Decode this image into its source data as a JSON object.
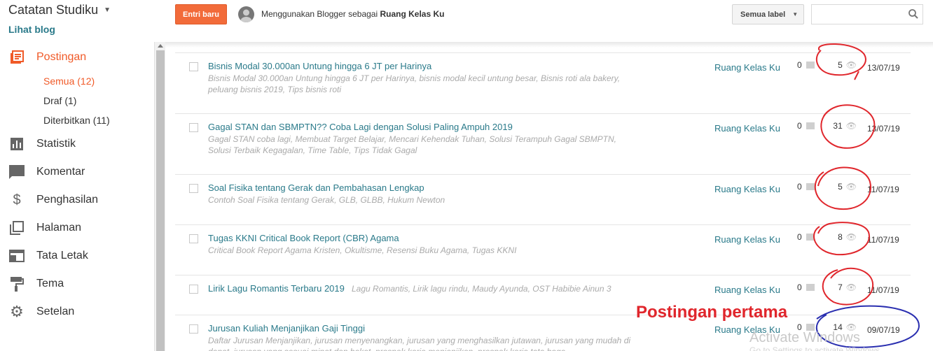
{
  "sidebar": {
    "blog_title": "Catatan Studiku",
    "view_blog": "Lihat blog",
    "items": [
      {
        "label": "Postingan",
        "icon": "posts-icon"
      },
      {
        "label": "Statistik",
        "icon": "stats-icon"
      },
      {
        "label": "Komentar",
        "icon": "comment-icon"
      },
      {
        "label": "Penghasilan",
        "icon": "dollar-icon"
      },
      {
        "label": "Halaman",
        "icon": "pages-icon"
      },
      {
        "label": "Tata Letak",
        "icon": "layout-icon"
      },
      {
        "label": "Tema",
        "icon": "paint-roller-icon"
      },
      {
        "label": "Setelan",
        "icon": "gear-icon"
      }
    ],
    "subitems": [
      "Semua (12)",
      "Draf (1)",
      "Diterbitkan (11)"
    ]
  },
  "topbar": {
    "new_entry": "Entri baru",
    "using_prefix": "Menggunakan Blogger sebagai ",
    "using_name": "Ruang Kelas Ku",
    "label_filter": "Semua label",
    "search_placeholder": ""
  },
  "posts": [
    {
      "title": "Bisnis Modal 30.000an Untung hingga 6 JT per Harinya",
      "labels": "Bisnis Modal 30.000an Untung hingga 6 JT per Harinya, bisnis modal kecil untung besar, Bisnis roti ala bakery, peluang bisnis 2019, Tips bisnis roti",
      "author": "Ruang Kelas Ku",
      "comments": "0",
      "views": "5",
      "date": "13/07/19"
    },
    {
      "title": "Gagal STAN dan SBMPTN?? Coba Lagi dengan Solusi Paling Ampuh 2019",
      "labels": "Gagal STAN coba lagi, Membuat Target Belajar, Mencari Kehendak Tuhan, Solusi Terampuh Gagal SBMPTN, Solusi Terbaik Kegagalan, Time Table, Tips Tidak Gagal",
      "author": "Ruang Kelas Ku",
      "comments": "0",
      "views": "31",
      "date": "13/07/19"
    },
    {
      "title": "Soal Fisika tentang Gerak dan Pembahasan Lengkap",
      "labels": "Contoh Soal Fisika tentang Gerak, GLB, GLBB, Hukum Newton",
      "author": "Ruang Kelas Ku",
      "comments": "0",
      "views": "5",
      "date": "11/07/19"
    },
    {
      "title": "Tugas KKNI Critical Book Report (CBR) Agama",
      "labels": "Critical Book Report Agama Kristen, Okultisme, Resensi Buku Agama, Tugas KKNI",
      "author": "Ruang Kelas Ku",
      "comments": "0",
      "views": "8",
      "date": "11/07/19"
    },
    {
      "title": "Lirik Lagu Romantis Terbaru 2019",
      "labels": "Lagu Romantis, Lirik lagu rindu, Maudy Ayunda, OST Habibie Ainun 3",
      "author": "Ruang Kelas Ku",
      "comments": "0",
      "views": "7",
      "date": "11/07/19"
    },
    {
      "title": "Jurusan Kuliah Menjanjikan Gaji Tinggi",
      "labels": "Daftar Jurusan Menjanjikan, jurusan menyenangkan, jurusan yang menghasilkan jutawan, jurusan yang mudah di dapat, jurusan yang sesuai minat dan bakat, prospek kerja menjanjikan, prospek kerja tata boga",
      "author": "Ruang Kelas Ku",
      "comments": "0",
      "views": "14",
      "date": "09/07/19"
    }
  ],
  "annotation": "Postingan pertama",
  "watermark": {
    "title": "Activate Windows",
    "subtitle": "Go to Settings to activate Windows."
  },
  "colors": {
    "accent": "#f05a28",
    "link": "#2a7a8a",
    "annot_red": "#e0262c",
    "annot_blue": "#2a2fb0"
  }
}
